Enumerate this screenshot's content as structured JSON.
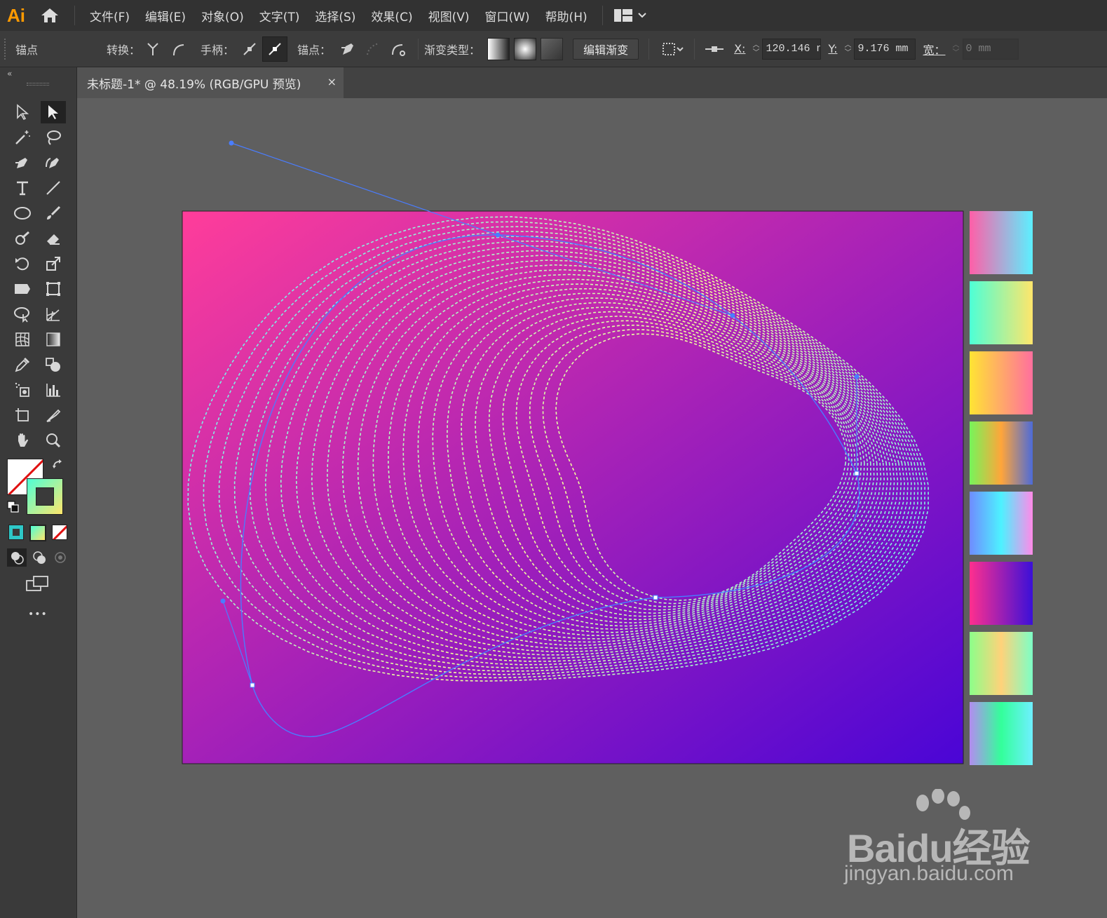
{
  "app": {
    "logo": "Ai"
  },
  "menu": [
    "文件(F)",
    "编辑(E)",
    "对象(O)",
    "文字(T)",
    "选择(S)",
    "效果(C)",
    "视图(V)",
    "窗口(W)",
    "帮助(H)"
  ],
  "control": {
    "selection_label": "锚点",
    "convert_label": "转换：",
    "handles_label": "手柄：",
    "anchors_label": "锚点：",
    "gradient_type_label": "渐变类型：",
    "edit_gradient": "编辑渐变",
    "x_label": "X:",
    "x_value": "120.146 n",
    "y_label": "Y:",
    "y_value": "9.176 mm",
    "w_label": "宽：",
    "w_value": "0 mm"
  },
  "tab": {
    "title": "未标题-1* @ 48.19% (RGB/GPU 预览)",
    "close": "×"
  },
  "toolbar": {
    "collapse": "«",
    "more": "•••"
  },
  "colors": {
    "artboard_start": "#ff3d9a",
    "artboard_end": "#4a05d6",
    "line_warm": "#f5ff9a",
    "line_cool": "#5ce8ff",
    "path": "#4a7dff"
  },
  "swatches": [
    [
      "#ff5fa8",
      "#5cf0ff"
    ],
    [
      "#4dffd6",
      "#ffe66b"
    ],
    [
      "#ffe433",
      "#ff6f9e"
    ],
    [
      "#76f55a",
      "#ffa53a",
      "#4d6bd8"
    ],
    [
      "#6f8cff",
      "#4df2ff",
      "#ff8ae8"
    ],
    [
      "#ff2f8e",
      "#3b10d8"
    ],
    [
      "#8cff8a",
      "#ffd27a",
      "#7dffc6"
    ],
    [
      "#b38cf0",
      "#33ff9a",
      "#6ef0ff"
    ]
  ],
  "watermark": {
    "brand": "Baidu经验",
    "domain": "jingyan.baidu.com"
  }
}
